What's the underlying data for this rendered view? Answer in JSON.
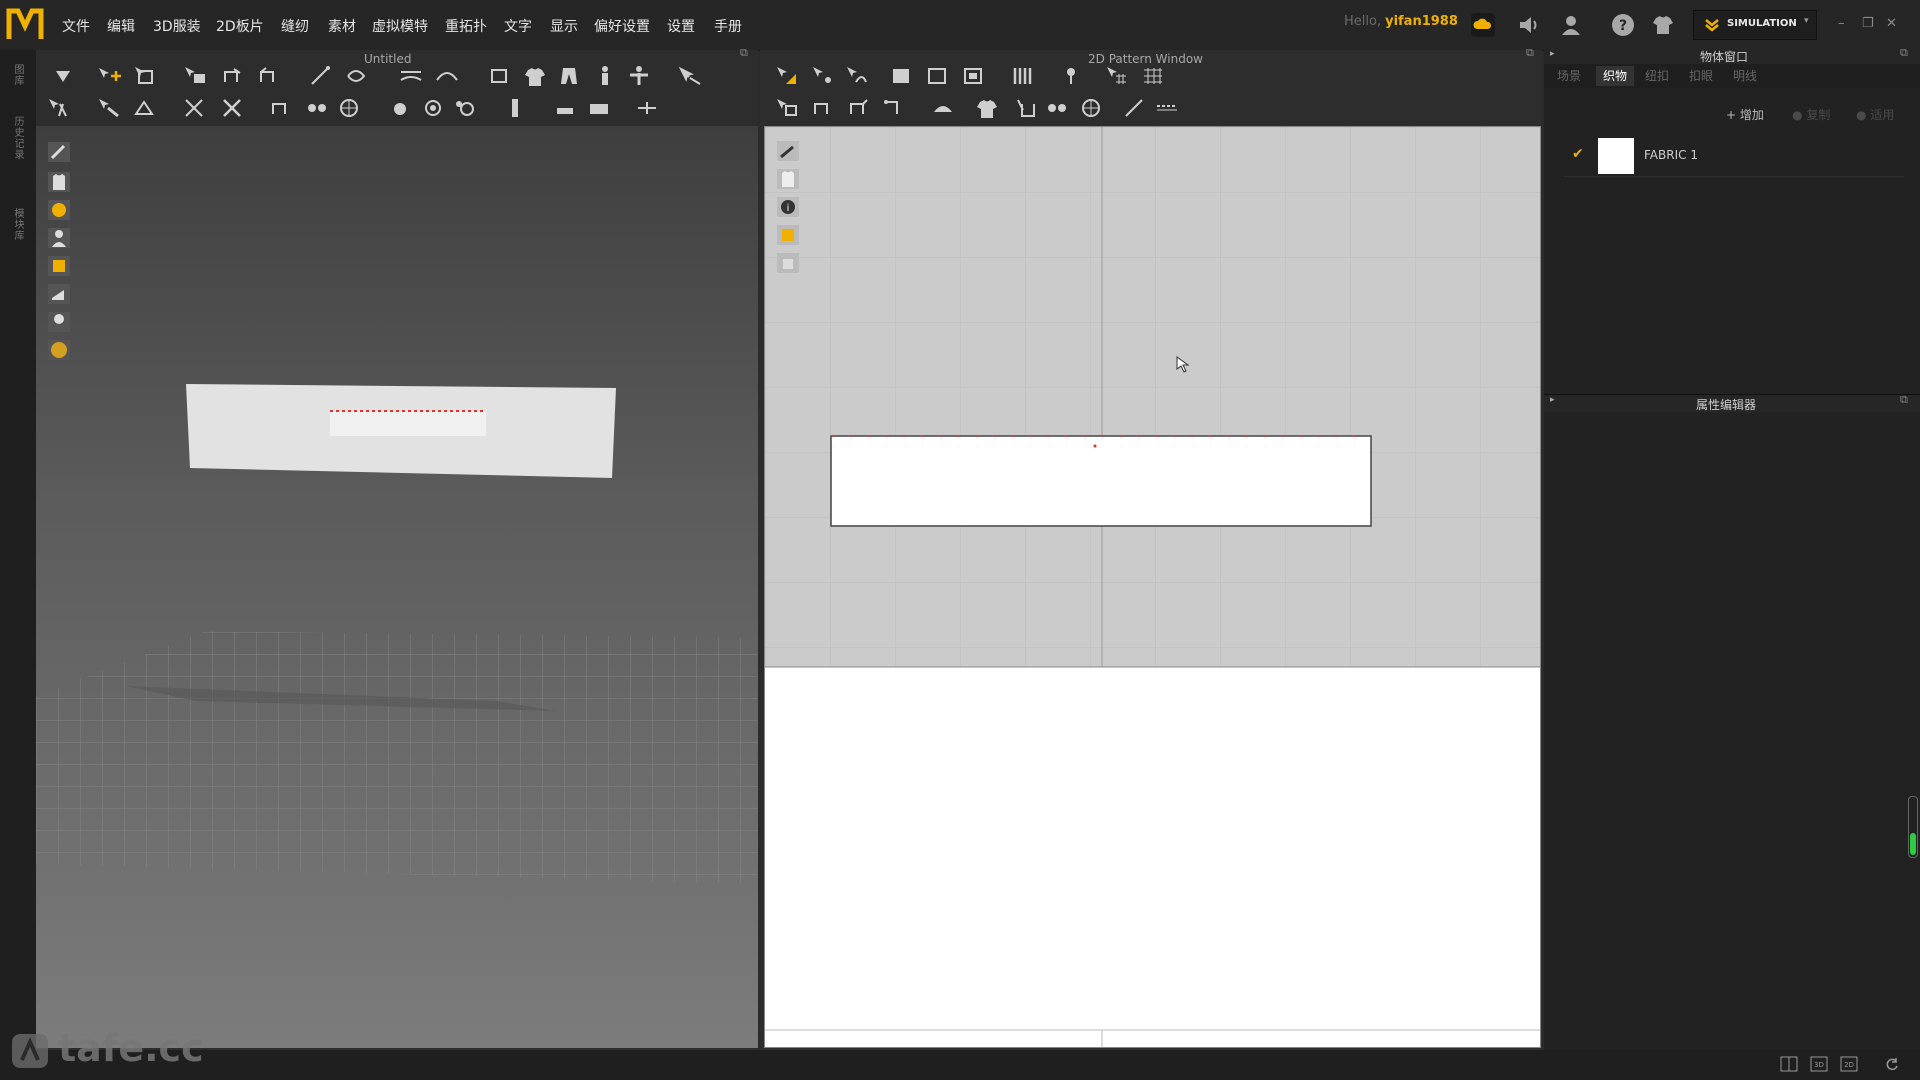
{
  "menu": {
    "items": [
      "文件",
      "编辑",
      "3D服装",
      "2D板片",
      "缝纫",
      "素材",
      "虚拟模特",
      "重拓扑",
      "文字",
      "显示",
      "偏好设置",
      "设置",
      "手册"
    ]
  },
  "user": {
    "greeting": "Hello,",
    "name": "yifan1988"
  },
  "simulation": {
    "label": "SIMULATION"
  },
  "left_strip": {
    "labels": [
      "图库",
      "历史记录",
      "模块库"
    ]
  },
  "panel3d": {
    "title": "Untitled"
  },
  "panel2d": {
    "title": "2D Pattern Window"
  },
  "object_window": {
    "title": "物体窗口",
    "tabs": [
      "场景",
      "织物",
      "纽扣",
      "扣眼",
      "明线"
    ],
    "active_tab": "织物",
    "buttons": {
      "add": "增加",
      "copy": "复制",
      "apply": "适用"
    },
    "fabrics": [
      {
        "name": "FABRIC 1",
        "color": "#ffffff",
        "checked": true
      }
    ]
  },
  "property_editor": {
    "title": "属性编辑器"
  },
  "watermark": {
    "text": "tafe.cc"
  },
  "colors": {
    "accent": "#f0b000",
    "selection_red": "#e03030"
  }
}
